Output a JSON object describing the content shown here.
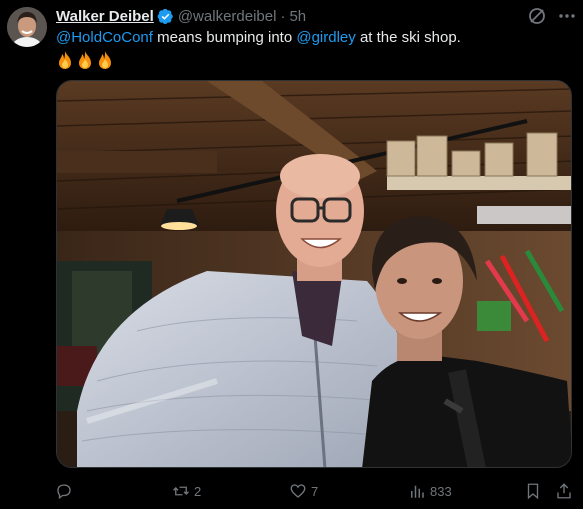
{
  "tweet": {
    "author_name": "Walker Deibel",
    "handle": "@walkerdeibel",
    "separator": "·",
    "time": "5h",
    "text": {
      "mention1": "@HoldCoConf",
      "part1": " means bumping into ",
      "mention2": "@girdley",
      "part2": " at the ski shop."
    },
    "emojis": [
      "fire",
      "fire",
      "fire"
    ]
  },
  "actions": {
    "reply_count": "",
    "retweet_count": "2",
    "like_count": "7",
    "views_count": "833"
  },
  "colors": {
    "background": "#000000",
    "text": "#e7e9ea",
    "muted": "#71767b",
    "accent": "#1d9bf0",
    "border": "#2f3336"
  },
  "icons": {
    "verified": "verified-badge-icon",
    "grok": "grok-icon",
    "more": "more-dots-icon",
    "reply": "reply-icon",
    "retweet": "retweet-icon",
    "like": "heart-icon",
    "views": "views-chart-icon",
    "bookmark": "bookmark-icon",
    "share": "share-icon"
  }
}
